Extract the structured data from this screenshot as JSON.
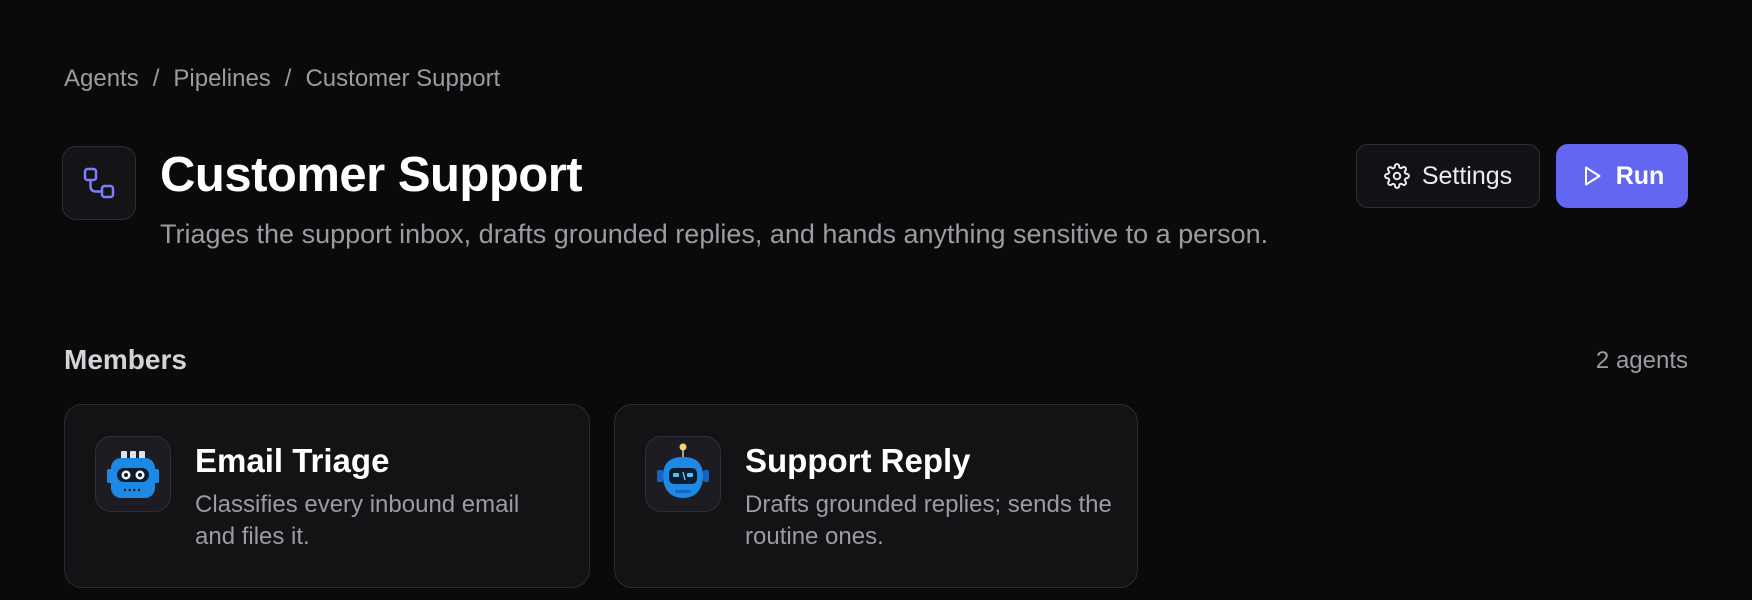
{
  "breadcrumb": {
    "items": [
      "Agents",
      "Pipelines",
      "Customer Support"
    ],
    "separator": "/"
  },
  "header": {
    "icon": "workflow-icon",
    "title": "Customer Support",
    "description": "Triages the support inbox, drafts grounded replies, and hands anything sensitive to a person."
  },
  "actions": {
    "settings": {
      "label": "Settings",
      "icon": "gear-icon"
    },
    "run": {
      "label": "Run",
      "icon": "play-icon"
    }
  },
  "members": {
    "title": "Members",
    "count": "2 agents",
    "agents": [
      {
        "name": "Email Triage",
        "description": "Classifies every inbound email and files it.",
        "avatar": "robot-avatar-icon"
      },
      {
        "name": "Support Reply",
        "description": "Drafts grounded replies; sends the routine ones.",
        "avatar": "robot-antenna-avatar-icon"
      }
    ]
  },
  "colors": {
    "background": "#0a0a0b",
    "accent": "#6366f1",
    "muted_text": "#9b9ba3",
    "card": "#131316",
    "border": "#2a2a30",
    "robot_blue": "#1e88e5"
  }
}
